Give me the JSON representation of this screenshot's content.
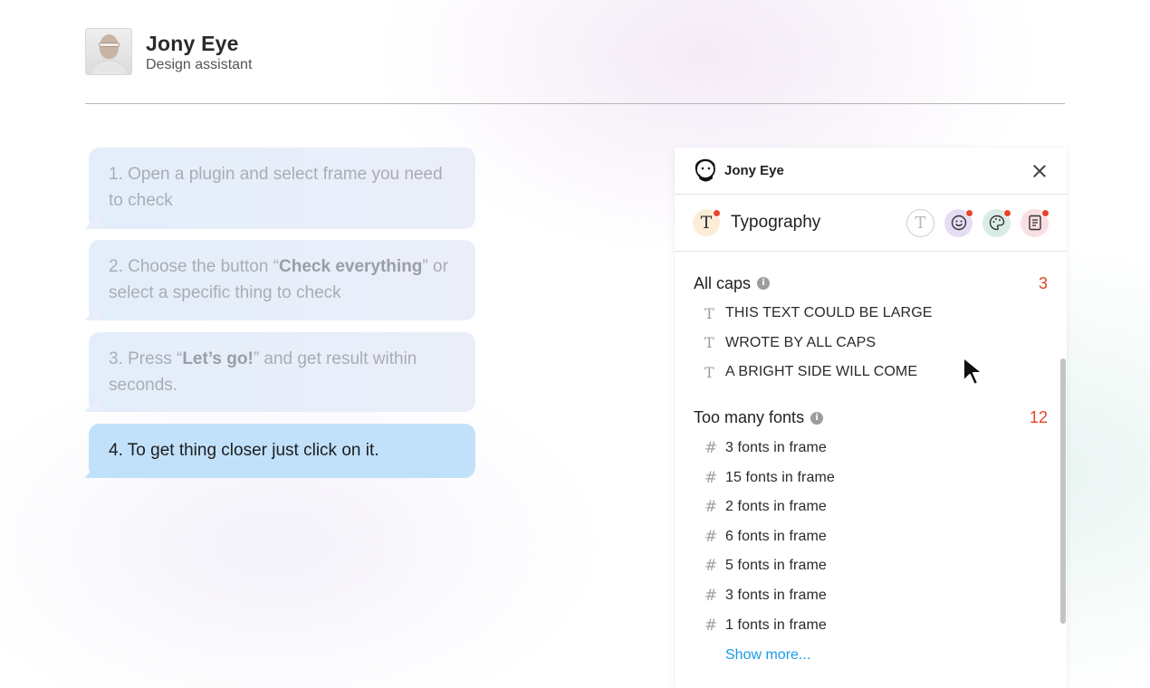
{
  "header": {
    "name": "Jony Eye",
    "role": "Design assistant"
  },
  "steps": [
    {
      "prefix": "1. Open a plugin and select frame you need to check",
      "bold": "",
      "suffix": ""
    },
    {
      "prefix": "2. Choose the button “",
      "bold": "Check everything",
      "suffix": "” or select a specific thing to check"
    },
    {
      "prefix": "3. Press “",
      "bold": "Let’s go!",
      "suffix": "” and get result within seconds."
    },
    {
      "prefix": "4. To get thing closer just click on it.",
      "bold": "",
      "suffix": ""
    }
  ],
  "panel": {
    "title": "Jony Eye",
    "active_tab": {
      "label": "Typography",
      "icon": "text-icon",
      "glyph": "T"
    },
    "tabs": [
      {
        "name": "text-tab-icon",
        "glyph": "T",
        "has_badge": false
      },
      {
        "name": "smiley-icon",
        "has_badge": true
      },
      {
        "name": "palette-icon",
        "has_badge": true
      },
      {
        "name": "document-icon",
        "has_badge": true
      }
    ],
    "sections": [
      {
        "title": "All caps",
        "count": "3",
        "glyph": "T",
        "items": [
          "THIS TEXT COULD BE LARGE",
          "WROTE BY ALL CAPS",
          "A BRIGHT SIDE WILL COME"
        ]
      },
      {
        "title": "Too many fonts",
        "count": "12",
        "glyph": "#",
        "items": [
          "3 fonts in frame",
          "15 fonts in frame",
          "2 fonts in frame",
          "6 fonts in frame",
          "5 fonts in frame",
          "3 fonts in frame",
          "1 fonts in frame"
        ]
      }
    ],
    "show_more": "Show more...",
    "info_glyph": "i"
  },
  "colors": {
    "accent_red": "#e2442b",
    "link_blue": "#1a9be4",
    "active_bubble": "#c1e1fb"
  }
}
